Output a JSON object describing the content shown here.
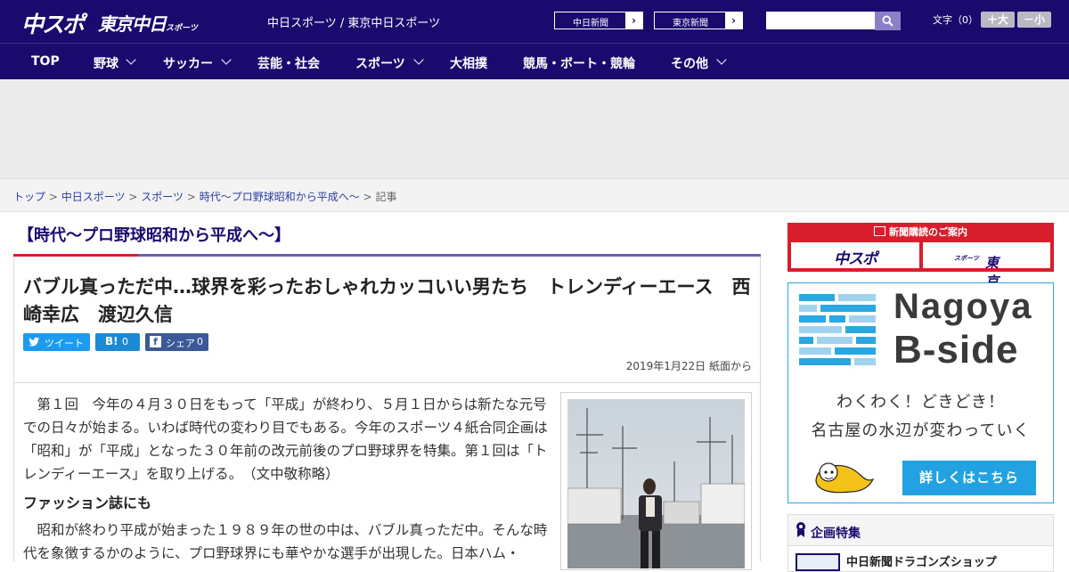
{
  "header": {
    "logo_chusupo": "中スポ",
    "logo_tokyo": "東京中日",
    "logo_tokyo_small": "スポーツ",
    "site_title": "中日スポーツ / 東京中日スポーツ",
    "newspaper_links": [
      "中日新聞",
      "東京新聞"
    ],
    "search_placeholder": "",
    "font_size_label": "文字（0）",
    "font_bigger": "＋大",
    "font_smaller": "－小"
  },
  "nav": {
    "items": [
      {
        "label": "TOP"
      },
      {
        "label": "野球"
      },
      {
        "label": "サッカー"
      },
      {
        "label": "芸能・社会"
      },
      {
        "label": "スポーツ"
      },
      {
        "label": "大相撲"
      },
      {
        "label": "競馬・ボート・競輪"
      },
      {
        "label": "その他"
      }
    ]
  },
  "breadcrumb": {
    "items": [
      "トップ",
      "中日スポーツ",
      "スポーツ",
      "時代～プロ野球昭和から平成へ～"
    ],
    "current": "記事",
    "separator": ">"
  },
  "article": {
    "series": "【時代～プロ野球昭和から平成へ～】",
    "headline": "バブル真っただ中…球界を彩ったおしゃれカッコいい男たち　トレンディーエース　西崎幸広　渡辺久信",
    "share": {
      "tweet": "ツイート",
      "hatena_icon": "B!",
      "hatena_count": "0",
      "facebook_icon": "f",
      "facebook_label": "シェア",
      "facebook_count": "0"
    },
    "date": "2019年1月22日 紙面から",
    "paragraph1": "　第１回　今年の４月３０日をもって「平成」が終わり、５月１日からは新たな元号での日々が始まる。いわば時代の変わり目でもある。今年のスポーツ４紙合同企画は「昭和」が「平成」となった３０年前の改元前後のプロ野球界を特集。第１回は「トレンディーエース」を取り上げる。　（文中敬称略）",
    "subheading": "ファッション誌にも",
    "paragraph2": "　昭和が終わり平成が始まった１９８９年の世の中は、バブル真っただ中。そんな時代を象徴するかのように、プロ野球界にも華やかな選手が出現した。日本ハム・"
  },
  "sidebar": {
    "subscribe": {
      "heading": "新聞購読のご案内",
      "logo1": "中スポ",
      "logo2": "東京中日",
      "logo2_small": "スポーツ"
    },
    "ad": {
      "title1": "Nagoya",
      "title2": "B-side",
      "line1": "わくわく！どきどき！",
      "line2": "名古屋の水辺が変わっていく",
      "button": "詳しくはこちら"
    },
    "features": {
      "title": "企画特集",
      "item1": "中日新聞ドラゴンズショップ"
    }
  },
  "colors": {
    "brand_navy": "#1b0a6e",
    "accent_red": "#d81e2c",
    "accent_purple": "#6c63b0",
    "sky_blue": "#22a2e0"
  }
}
